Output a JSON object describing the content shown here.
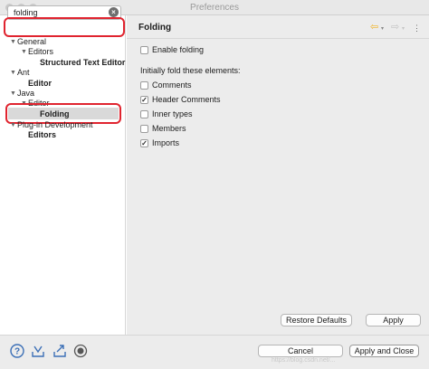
{
  "window": {
    "title": "Preferences"
  },
  "sidebar": {
    "search": {
      "value": "folding",
      "placeholder": ""
    },
    "tree": [
      {
        "label": "General",
        "bold": false
      },
      {
        "label": "Editors",
        "bold": false
      },
      {
        "label": "Structured Text Editor",
        "bold": true
      },
      {
        "label": "Ant",
        "bold": false
      },
      {
        "label": "Editor",
        "bold": true
      },
      {
        "label": "Java",
        "bold": false
      },
      {
        "label": "Editor",
        "bold": false
      },
      {
        "label": "Folding",
        "bold": true,
        "selected": true
      },
      {
        "label": "Plug-in Development",
        "bold": false
      },
      {
        "label": "Editors",
        "bold": true
      }
    ]
  },
  "page": {
    "title": "Folding",
    "enable_folding": {
      "label": "Enable folding",
      "checked": false
    },
    "section_label": "Initially fold these elements:",
    "elements": [
      {
        "label": "Comments",
        "checked": false
      },
      {
        "label": "Header Comments",
        "checked": true
      },
      {
        "label": "Inner types",
        "checked": false
      },
      {
        "label": "Members",
        "checked": false
      },
      {
        "label": "Imports",
        "checked": true
      }
    ],
    "restore_defaults_label": "Restore Defaults",
    "apply_label": "Apply"
  },
  "footer": {
    "cancel_label": "Cancel",
    "apply_close_label": "Apply and Close",
    "watermark": "https://blog.csdn.net/..."
  },
  "colors": {
    "highlight_red": "#e0242f",
    "nav_back_arrow": "#f0b429"
  },
  "icons": {
    "help": "help-icon",
    "import": "import-icon",
    "export": "export-icon",
    "record": "record-icon",
    "clear": "clear-search-icon",
    "back": "back-arrow-icon",
    "forward": "forward-arrow-icon",
    "menu": "view-menu-icon"
  }
}
